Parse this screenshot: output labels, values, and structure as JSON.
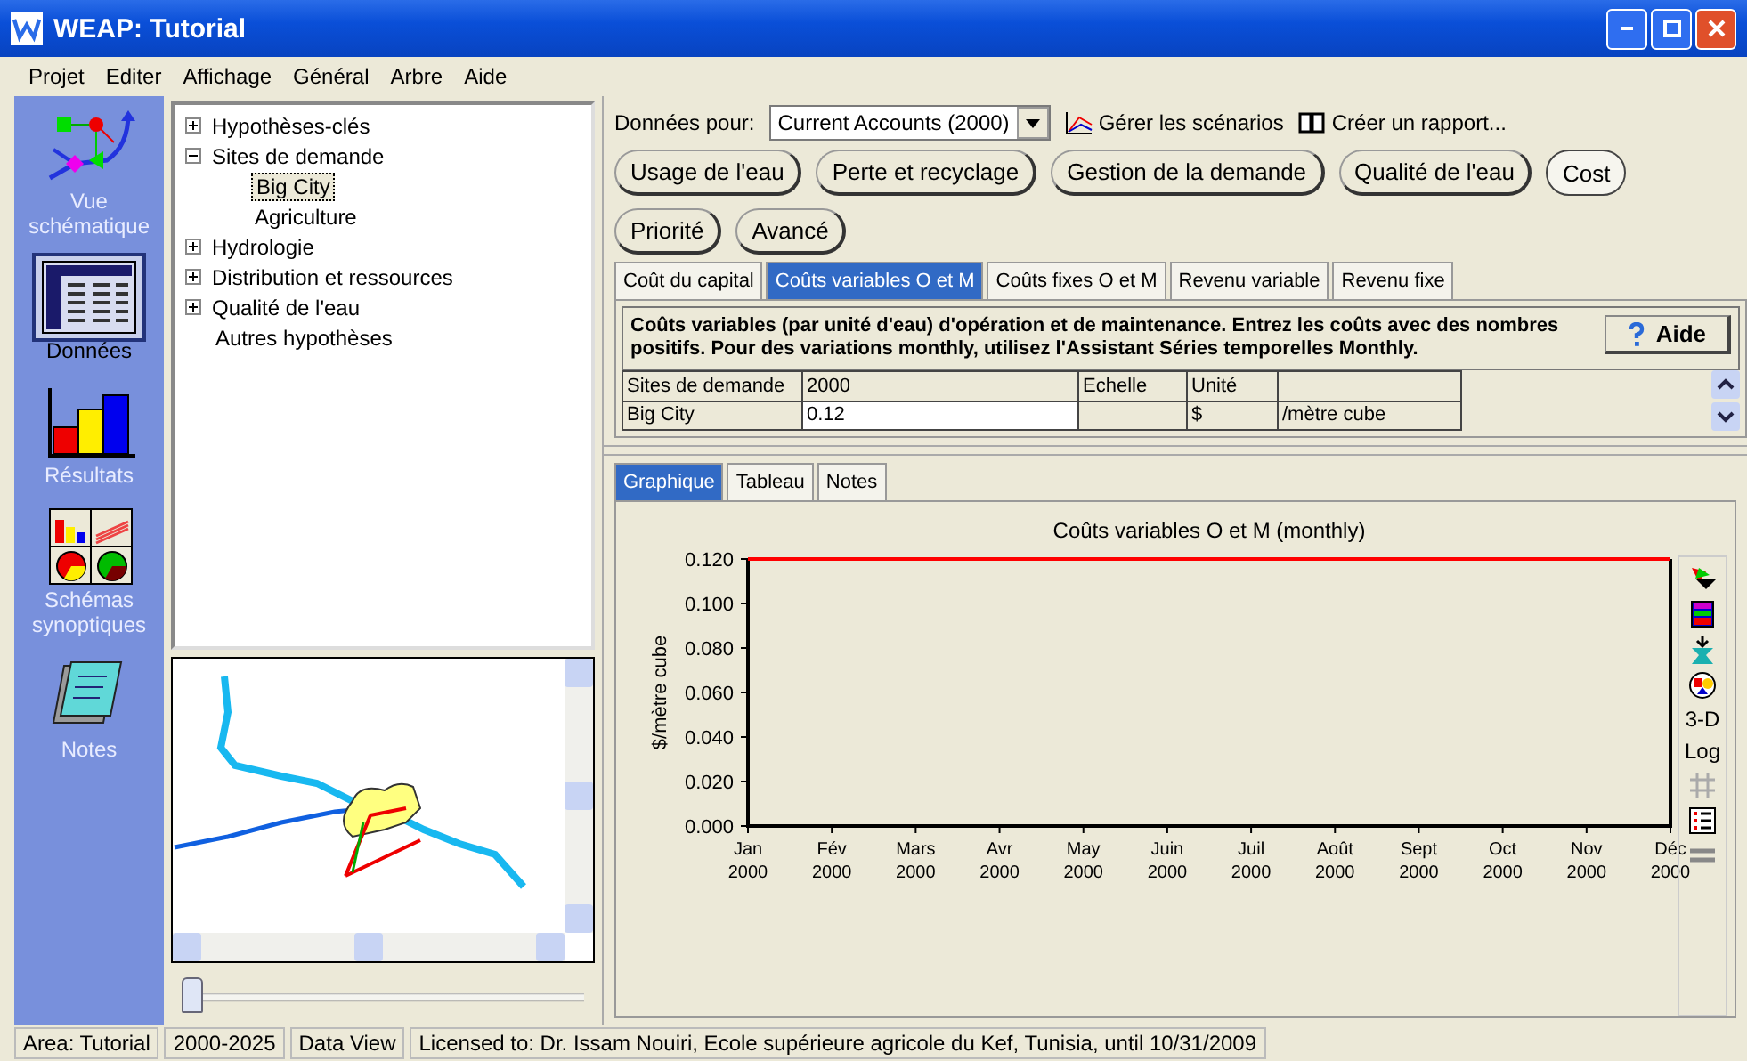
{
  "window": {
    "title": "WEAP: Tutorial"
  },
  "menu": [
    "Projet",
    "Editer",
    "Affichage",
    "Général",
    "Arbre",
    "Aide"
  ],
  "sidebar": {
    "items": [
      {
        "kind": "schematic",
        "label": "Vue schématique",
        "selected": false
      },
      {
        "kind": "data",
        "label": "Données",
        "selected": true
      },
      {
        "kind": "results",
        "label": "Résultats",
        "selected": false
      },
      {
        "kind": "overviews",
        "label": "Schémas synoptiques",
        "selected": false
      },
      {
        "kind": "notes",
        "label": "Notes",
        "selected": false
      }
    ]
  },
  "tree": {
    "items": [
      {
        "kind": "folder",
        "label": "Hypothèses-clés",
        "expanded": false,
        "selected": false
      },
      {
        "kind": "folder",
        "label": "Sites de demande",
        "expanded": true,
        "selected": false,
        "children": [
          {
            "kind": "leaf",
            "label": "Big City",
            "selected": true
          },
          {
            "kind": "leaf",
            "label": "Agriculture",
            "selected": false
          }
        ]
      },
      {
        "kind": "folder",
        "label": "Hydrologie",
        "expanded": false,
        "selected": false
      },
      {
        "kind": "folder",
        "label": "Distribution et ressources",
        "expanded": false,
        "selected": false
      },
      {
        "kind": "folder",
        "label": "Qualité de l'eau",
        "expanded": false,
        "selected": false
      },
      {
        "kind": "leaf",
        "label": "Autres hypothèses",
        "selected": false
      }
    ]
  },
  "time_slider": {
    "level": 0
  },
  "toolbar": {
    "data_for_label": "Données pour:",
    "data_for_value": "Current Accounts (2000)",
    "links": [
      "Gérer les scénarios",
      "Créer un rapport..."
    ]
  },
  "categories": [
    {
      "label": "Usage de l'eau",
      "selected": false
    },
    {
      "label": "Perte et recyclage",
      "selected": false
    },
    {
      "label": "Gestion de la demande",
      "selected": false
    },
    {
      "label": "Qualité de l'eau",
      "selected": false
    },
    {
      "label": "Cost",
      "selected": true
    },
    {
      "label": "Priorité",
      "selected": false
    },
    {
      "label": "Avancé",
      "selected": false
    }
  ],
  "tabs": [
    {
      "label": "Coût du capital",
      "selected": false
    },
    {
      "label": "Coûts variables O et M",
      "selected": true
    },
    {
      "label": "Coûts fixes O et M",
      "selected": false
    },
    {
      "label": "Revenu variable",
      "selected": false
    },
    {
      "label": "Revenu fixe",
      "selected": false
    }
  ],
  "description": "Coûts variables (par unité d'eau) d'opération et de maintenance. Entrez les coûts avec des nombres positifs.  Pour des variations monthly, utilisez l'Assistant Séries temporelles Monthly.",
  "help_button": "Aide",
  "table": {
    "columns": [
      "Sites de demande",
      "2000",
      "Echelle",
      "Unité"
    ],
    "rows": [
      {
        "site": "Big City",
        "value": "0.12",
        "unit": "$",
        "unit_suffix": "/mètre cube"
      }
    ]
  },
  "view_tabs": [
    {
      "label": "Graphique",
      "selected": true
    },
    {
      "label": "Tableau",
      "selected": false
    },
    {
      "label": "Notes",
      "selected": false
    }
  ],
  "chart": {
    "chart_data": {
      "type": "line",
      "title": "Coûts variables O et M (monthly)",
      "ylabel": "$/mètre cube",
      "categories": [
        "Jan 2000",
        "Fév 2000",
        "Mars 2000",
        "Avr 2000",
        "May 2000",
        "Juin 2000",
        "Juil 2000",
        "Août 2000",
        "Sept 2000",
        "Oct 2000",
        "Nov 2000",
        "Déc 2000"
      ],
      "series": [
        {
          "color": "#ff0000",
          "values": [
            0.12,
            0.12,
            0.12,
            0.12,
            0.12,
            0.12,
            0.12,
            0.12,
            0.12,
            0.12,
            0.12,
            0.12
          ]
        }
      ],
      "ylim": [
        0,
        0.12
      ],
      "yticks": [
        {
          "value": 0,
          "label": "0.000"
        },
        {
          "value": 0.02,
          "label": "0.020"
        },
        {
          "value": 0.04,
          "label": "0.040"
        },
        {
          "value": 0.06,
          "label": "0.060"
        },
        {
          "value": 0.08,
          "label": "0.080"
        },
        {
          "value": 0.1,
          "label": "0.100"
        },
        {
          "value": 0.12,
          "label": "0.120"
        }
      ]
    },
    "tools": [
      {
        "kind": "palette"
      },
      {
        "kind": "colors"
      },
      {
        "kind": "export"
      },
      {
        "kind": "shapes"
      },
      {
        "kind": "text",
        "label": "3-D"
      },
      {
        "kind": "text",
        "label": "Log"
      },
      {
        "kind": "grid"
      },
      {
        "kind": "legend"
      },
      {
        "kind": "lines"
      }
    ]
  },
  "status_bar": [
    "Area: Tutorial",
    "2000-2025",
    "Data View",
    "Licensed to: Dr. Issam Nouiri, Ecole supérieure agricole du Kef, Tunisia, until 10/31/2009"
  ]
}
